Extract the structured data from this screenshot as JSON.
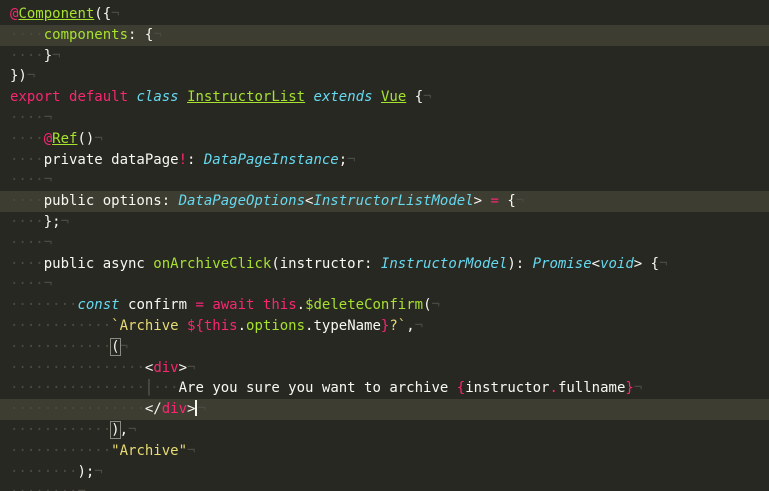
{
  "editor": {
    "language": "typescript",
    "theme": {
      "background": "#272822",
      "line_highlight": "#3e3d32",
      "default": "#f8f8f2",
      "keyword": "#f92672",
      "entity": "#a6e22e",
      "type": "#66d9ef",
      "string": "#e6db74",
      "invisible": "#4a4a42"
    },
    "lines": [
      {
        "indent": 0,
        "hl": false,
        "tokens": [
          [
            "@",
            "k"
          ],
          [
            "Component",
            "eu"
          ],
          [
            "({",
            ""
          ]
        ]
      },
      {
        "indent": 1,
        "hl": true,
        "tokens": [
          [
            "components",
            "e"
          ],
          [
            ": {",
            ""
          ]
        ]
      },
      {
        "indent": 1,
        "hl": false,
        "tokens": [
          [
            "}",
            ""
          ]
        ]
      },
      {
        "indent": 0,
        "hl": false,
        "tokens": [
          [
            "})",
            ""
          ]
        ]
      },
      {
        "indent": 0,
        "hl": false,
        "tokens": [
          [
            "export",
            "k"
          ],
          [
            " ",
            ""
          ],
          [
            "default",
            "k"
          ],
          [
            " ",
            ""
          ],
          [
            "class",
            "ti"
          ],
          [
            " ",
            ""
          ],
          [
            "InstructorList",
            "eu"
          ],
          [
            " ",
            ""
          ],
          [
            "extends",
            "ti"
          ],
          [
            " ",
            ""
          ],
          [
            "Vue",
            "eu"
          ],
          [
            " {",
            ""
          ]
        ]
      },
      {
        "indent": 1,
        "hl": false,
        "tokens": []
      },
      {
        "indent": 1,
        "hl": false,
        "tokens": [
          [
            "@",
            "k"
          ],
          [
            "Ref",
            "eu"
          ],
          [
            "()",
            ""
          ]
        ]
      },
      {
        "indent": 1,
        "hl": false,
        "tokens": [
          [
            "private dataPage",
            ""
          ],
          [
            "!",
            "k"
          ],
          [
            ": ",
            ""
          ],
          [
            "DataPageInstance",
            "ti"
          ],
          [
            ";",
            ""
          ]
        ]
      },
      {
        "indent": 1,
        "hl": false,
        "tokens": []
      },
      {
        "indent": 1,
        "hl": true,
        "tokens": [
          [
            "public options: ",
            ""
          ],
          [
            "DataPageOptions",
            "ti"
          ],
          [
            "<",
            ""
          ],
          [
            "InstructorListModel",
            "ti"
          ],
          [
            "> ",
            ""
          ],
          [
            "=",
            "k"
          ],
          [
            " {",
            ""
          ]
        ]
      },
      {
        "indent": 1,
        "hl": false,
        "tokens": [
          [
            "};",
            ""
          ]
        ]
      },
      {
        "indent": 1,
        "hl": false,
        "tokens": []
      },
      {
        "indent": 1,
        "hl": false,
        "tokens": [
          [
            "public async ",
            ""
          ],
          [
            "onArchiveClick",
            "e"
          ],
          [
            "(instructor: ",
            ""
          ],
          [
            "InstructorModel",
            "ti"
          ],
          [
            "): ",
            ""
          ],
          [
            "Promise",
            "ti"
          ],
          [
            "<",
            ""
          ],
          [
            "void",
            "ti"
          ],
          [
            "> {",
            ""
          ]
        ]
      },
      {
        "indent": 1,
        "hl": false,
        "tokens": []
      },
      {
        "indent": 2,
        "hl": false,
        "tokens": [
          [
            "const",
            "ti"
          ],
          [
            " confirm ",
            ""
          ],
          [
            "=",
            "k"
          ],
          [
            " ",
            ""
          ],
          [
            "await",
            "k"
          ],
          [
            " ",
            ""
          ],
          [
            "this",
            "k"
          ],
          [
            ".",
            ""
          ],
          [
            "$deleteConfirm",
            "e"
          ],
          [
            "(",
            ""
          ]
        ]
      },
      {
        "indent": 3,
        "hl": false,
        "tokens": [
          [
            "`Archive ",
            "s"
          ],
          [
            "${",
            "k"
          ],
          [
            "this",
            "k"
          ],
          [
            ".",
            ""
          ],
          [
            "options",
            "e"
          ],
          [
            ".",
            ""
          ],
          [
            "typeName",
            ""
          ],
          [
            "}",
            "k"
          ],
          [
            "?`",
            "s"
          ],
          [
            ",",
            ""
          ]
        ]
      },
      {
        "indent": 3,
        "hl": false,
        "tokens": [
          [
            "(",
            "m"
          ]
        ]
      },
      {
        "indent": 4,
        "hl": false,
        "tokens": [
          [
            "<",
            ""
          ],
          [
            "div",
            "k"
          ],
          [
            ">",
            ""
          ]
        ]
      },
      {
        "indent": 5,
        "hl": false,
        "tokens": [
          [
            "Are you sure you want to archive ",
            ""
          ],
          [
            "{",
            "k"
          ],
          [
            "instructor",
            ""
          ],
          [
            ".",
            "k"
          ],
          [
            "fullname",
            ""
          ],
          [
            "}",
            "k"
          ]
        ]
      },
      {
        "indent": 4,
        "hl": true,
        "tokens": [
          [
            "</",
            ""
          ],
          [
            "div",
            "k"
          ],
          [
            ">",
            ""
          ],
          [
            "",
            "c"
          ]
        ]
      },
      {
        "indent": 3,
        "hl": false,
        "tokens": [
          [
            ")",
            "m"
          ],
          [
            ",",
            ""
          ]
        ]
      },
      {
        "indent": 3,
        "hl": false,
        "tokens": [
          [
            "\"Archive\"",
            "s"
          ]
        ]
      },
      {
        "indent": 2,
        "hl": false,
        "tokens": [
          [
            ");",
            ""
          ]
        ]
      },
      {
        "indent": 2,
        "hl": false,
        "tokens": []
      }
    ]
  }
}
